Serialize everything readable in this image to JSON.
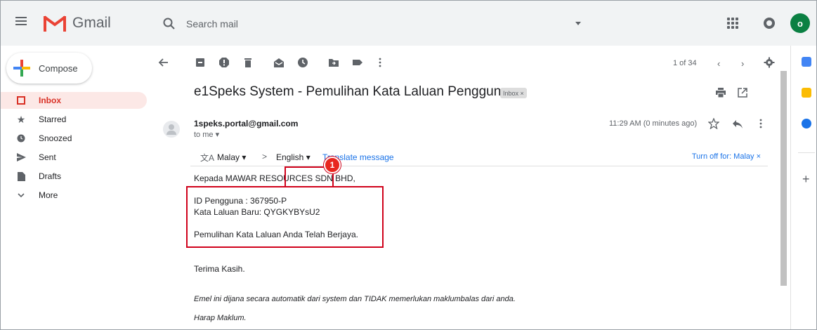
{
  "header": {
    "app_name": "Gmail",
    "search_placeholder": "Search mail",
    "avatar_initial": "o"
  },
  "sidebar": {
    "compose_label": "Compose",
    "items": [
      {
        "label": "Inbox",
        "icon": "inbox-icon",
        "active": true
      },
      {
        "label": "Starred",
        "icon": "star-icon"
      },
      {
        "label": "Snoozed",
        "icon": "clock-icon"
      },
      {
        "label": "Sent",
        "icon": "send-icon"
      },
      {
        "label": "Drafts",
        "icon": "draft-icon"
      },
      {
        "label": "More",
        "icon": "chevron-down-icon"
      }
    ]
  },
  "toolbar": {
    "pager": "1 of 34"
  },
  "message": {
    "subject": "e1Speks System - Pemulihan Kata Laluan Pengguna",
    "label_chip": "Inbox ×",
    "sender": "1speks.portal@gmail.com",
    "to": "to me ▾",
    "time": "11:29 AM (0 minutes ago)",
    "translate": {
      "from": "Malay ▾",
      "arrow": ">",
      "to": "English ▾",
      "link": "Translate message",
      "off": "Turn off for: Malay ×"
    },
    "body": {
      "greeting": "Kepada MAWAR RESOURCES SDN BHD,",
      "user_id": "ID Pengguna : 367950-P",
      "new_password": "Kata Laluan Baru: QYGKYBYsU2",
      "success": "Pemulihan Kata Laluan Anda Telah Berjaya.",
      "thanks": "Terima Kasih.",
      "auto_note": "Emel ini dijana secara automatik dari system dan TIDAK memerlukan maklumbalas dari anda.",
      "closing": "Harap Maklum."
    }
  },
  "callout": {
    "number": "1",
    "color": "#d0021b"
  },
  "colors": {
    "inbox_active_bg": "#fce8e6",
    "inbox_active_text": "#d93025",
    "link_blue": "#1a73e8",
    "avatar_green": "#0b8043"
  }
}
